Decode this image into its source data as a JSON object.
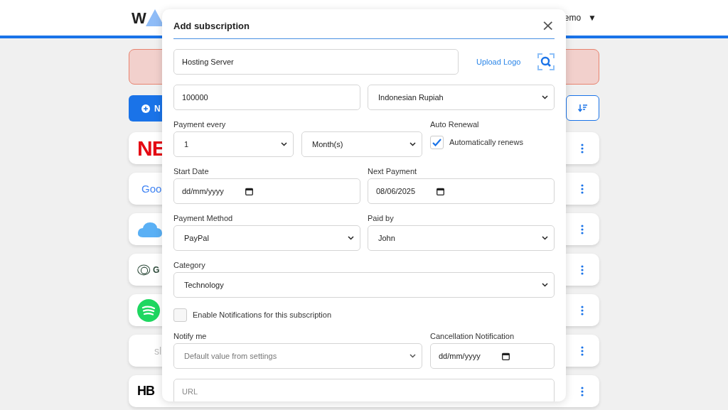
{
  "header": {
    "logo_letter": "W",
    "user_name": "emo",
    "user_caret": "▼"
  },
  "toolbar": {
    "new_button_label": "N"
  },
  "subscriptions": [
    {
      "kind": "red-wordmark",
      "logo_text": "NE"
    },
    {
      "kind": "multicolor-wordmark",
      "logo_text": "Goo"
    },
    {
      "kind": "cloud"
    },
    {
      "kind": "ring-letter",
      "logo_text": "G"
    },
    {
      "kind": "green-circle"
    },
    {
      "kind": "faded-wordmark",
      "logo_text": "sl"
    },
    {
      "kind": "black-wordmark",
      "logo_text": "HB"
    }
  ],
  "modal": {
    "title": "Add subscription",
    "close": "×",
    "name": {
      "value": "Hosting Server"
    },
    "upload_logo": "Upload Logo",
    "price": {
      "value": "100000"
    },
    "currency": {
      "value": "Indonesian Rupiah"
    },
    "payment_every": {
      "label": "Payment every",
      "count": "1",
      "unit": "Month(s)"
    },
    "auto_renewal": {
      "label": "Auto Renewal",
      "checkbox_label": "Automatically renews",
      "checked": true
    },
    "start_date": {
      "label": "Start Date",
      "placeholder": "dd/mm/yyyy"
    },
    "next_payment": {
      "label": "Next Payment",
      "value": "08/06/2025"
    },
    "payment_method": {
      "label": "Payment Method",
      "value": "PayPal"
    },
    "paid_by": {
      "label": "Paid by",
      "value": "John"
    },
    "category": {
      "label": "Category",
      "value": "Technology"
    },
    "notifications": {
      "label": "Enable Notifications for this subscription",
      "checked": false
    },
    "notify_me": {
      "label": "Notify me",
      "value": "Default value from settings",
      "disabled": true
    },
    "cancellation_notification": {
      "label": "Cancellation Notification",
      "placeholder": "dd/mm/yyyy"
    },
    "url": {
      "placeholder": "URL"
    }
  }
}
